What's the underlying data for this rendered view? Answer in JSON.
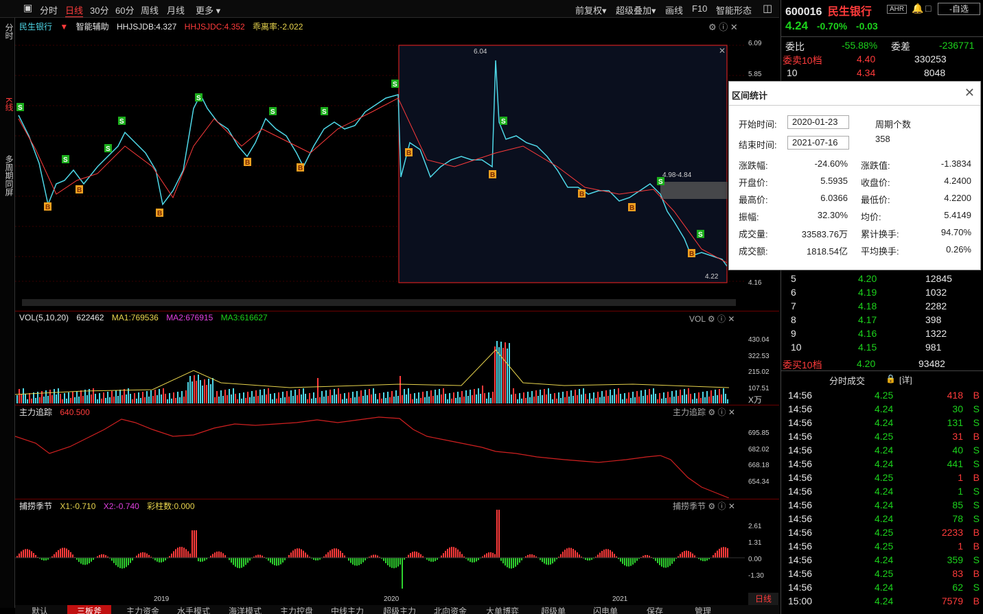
{
  "toolbar": {
    "periods": [
      "分时",
      "日线",
      "30分",
      "60分",
      "周线",
      "月线",
      "更多"
    ],
    "active_period": "日线",
    "right_buttons": [
      "前复权",
      "超级叠加",
      "画线",
      "F10",
      "智能形态"
    ]
  },
  "left_tabs": [
    "分时",
    "K线",
    "多周期同屏"
  ],
  "main_legend": {
    "stock_name": "民生银行",
    "assist": "智能辅助",
    "hhjsjdb": "HHJSJDB:4.327",
    "hhjsjdc": "HHJSJDC:4.352",
    "deviation": "乖离率:-2.022"
  },
  "main_axis": [
    "6.09",
    "5.85",
    "4.16"
  ],
  "price_annotations": {
    "high": "6.04",
    "low": "4.22",
    "range": "4.98-4.84"
  },
  "volume_legend": {
    "title": "VOL(5,10,20)",
    "value": "622462",
    "ma1": "MA1:769536",
    "ma2": "MA2:676915",
    "ma3": "MA3:616627",
    "tag": "VOL"
  },
  "volume_axis": [
    "430.04",
    "322.53",
    "215.02",
    "107.51",
    "X万"
  ],
  "tracking_legend": {
    "title": "主力追踪",
    "value": "640.500",
    "tag": "主力追踪"
  },
  "tracking_axis": [
    "695.85",
    "682.02",
    "668.18",
    "654.34"
  ],
  "season_legend": {
    "title": "捕捞季节",
    "x1": "X1:-0.710",
    "x2": "X2:-0.740",
    "bar": "彩柱数:0.000",
    "tag": "捕捞季节"
  },
  "season_axis": [
    "2.61",
    "1.31",
    "0.00",
    "-1.30"
  ],
  "x_axis_years": [
    "2019",
    "2020",
    "2021"
  ],
  "period_badge": "日线",
  "bottom_tabs": [
    "默认",
    "三板斧",
    "主力资金",
    "水手模式",
    "海洋模式",
    "主力控盘",
    "中线主力",
    "超级主力",
    "北向资金",
    "大单博弈",
    "超级单",
    "闪电单",
    "保存",
    "管理"
  ],
  "active_bottom_tab": "三板斧",
  "quote": {
    "code": "600016",
    "name": "民生银行",
    "ahr": "AHR",
    "watch": "-自选",
    "price": "4.24",
    "change_pct": "-0.70%",
    "change": "-0.03",
    "webi_label": "委比",
    "webi": "-55.88%",
    "weicha_label": "委差",
    "weicha": "-236771",
    "sell_header": "委卖10档",
    "sell_price": "4.40",
    "sell_vol": "330253",
    "sell_row_10": {
      "level": "10",
      "price": "4.34",
      "vol": "8048"
    },
    "buy_rows": [
      {
        "level": "5",
        "price": "4.20",
        "vol": "12845"
      },
      {
        "level": "6",
        "price": "4.19",
        "vol": "1032"
      },
      {
        "level": "7",
        "price": "4.18",
        "vol": "2282"
      },
      {
        "level": "8",
        "price": "4.17",
        "vol": "398"
      },
      {
        "level": "9",
        "price": "4.16",
        "vol": "1322"
      },
      {
        "level": "10",
        "price": "4.15",
        "vol": "981"
      }
    ],
    "buy_header": "委买10档",
    "buy_price": "4.20",
    "buy_vol": "93482",
    "trades_title": "分时成交",
    "trades_detail": "[详]",
    "trades": [
      {
        "time": "14:56",
        "price": "4.25",
        "vol": "418",
        "side": "B"
      },
      {
        "time": "14:56",
        "price": "4.24",
        "vol": "30",
        "side": "S"
      },
      {
        "time": "14:56",
        "price": "4.24",
        "vol": "131",
        "side": "S"
      },
      {
        "time": "14:56",
        "price": "4.25",
        "vol": "31",
        "side": "B"
      },
      {
        "time": "14:56",
        "price": "4.24",
        "vol": "40",
        "side": "S"
      },
      {
        "time": "14:56",
        "price": "4.24",
        "vol": "441",
        "side": "S"
      },
      {
        "time": "14:56",
        "price": "4.25",
        "vol": "1",
        "side": "B"
      },
      {
        "time": "14:56",
        "price": "4.24",
        "vol": "1",
        "side": "S"
      },
      {
        "time": "14:56",
        "price": "4.24",
        "vol": "85",
        "side": "S"
      },
      {
        "time": "14:56",
        "price": "4.24",
        "vol": "78",
        "side": "S"
      },
      {
        "time": "14:56",
        "price": "4.25",
        "vol": "2233",
        "side": "B"
      },
      {
        "time": "14:56",
        "price": "4.25",
        "vol": "1",
        "side": "B"
      },
      {
        "time": "14:56",
        "price": "4.24",
        "vol": "359",
        "side": "S"
      },
      {
        "time": "14:56",
        "price": "4.25",
        "vol": "83",
        "side": "B"
      },
      {
        "time": "14:56",
        "price": "4.24",
        "vol": "62",
        "side": "S"
      },
      {
        "time": "15:00",
        "price": "4.24",
        "vol": "7579",
        "side": "B"
      }
    ]
  },
  "popup": {
    "title": "区间统计",
    "start_label": "开始时间:",
    "start_value": "2020-01-23",
    "end_label": "结束时间:",
    "end_value": "2021-07-16",
    "period_count_label": "周期个数",
    "period_count": "358",
    "stats_left": [
      {
        "label": "涨跌幅:",
        "value": "-24.60%"
      },
      {
        "label": "开盘价:",
        "value": "5.5935"
      },
      {
        "label": "最高价:",
        "value": "6.0366"
      },
      {
        "label": "振幅:",
        "value": "32.30%"
      },
      {
        "label": "成交量:",
        "value": "33583.76万"
      },
      {
        "label": "成交额:",
        "value": "1818.54亿"
      }
    ],
    "stats_right": [
      {
        "label": "涨跌值:",
        "value": "-1.3834"
      },
      {
        "label": "收盘价:",
        "value": "4.2400"
      },
      {
        "label": "最低价:",
        "value": "4.2200"
      },
      {
        "label": "均价:",
        "value": "5.4149"
      },
      {
        "label": "累计换手:",
        "value": "94.70%"
      },
      {
        "label": "平均换手:",
        "value": "0.26%"
      }
    ]
  },
  "colors": {
    "up": "#ff3b3b",
    "down": "#4fd8e8",
    "accent": "#ff3b3b",
    "green": "#1cd21c"
  }
}
